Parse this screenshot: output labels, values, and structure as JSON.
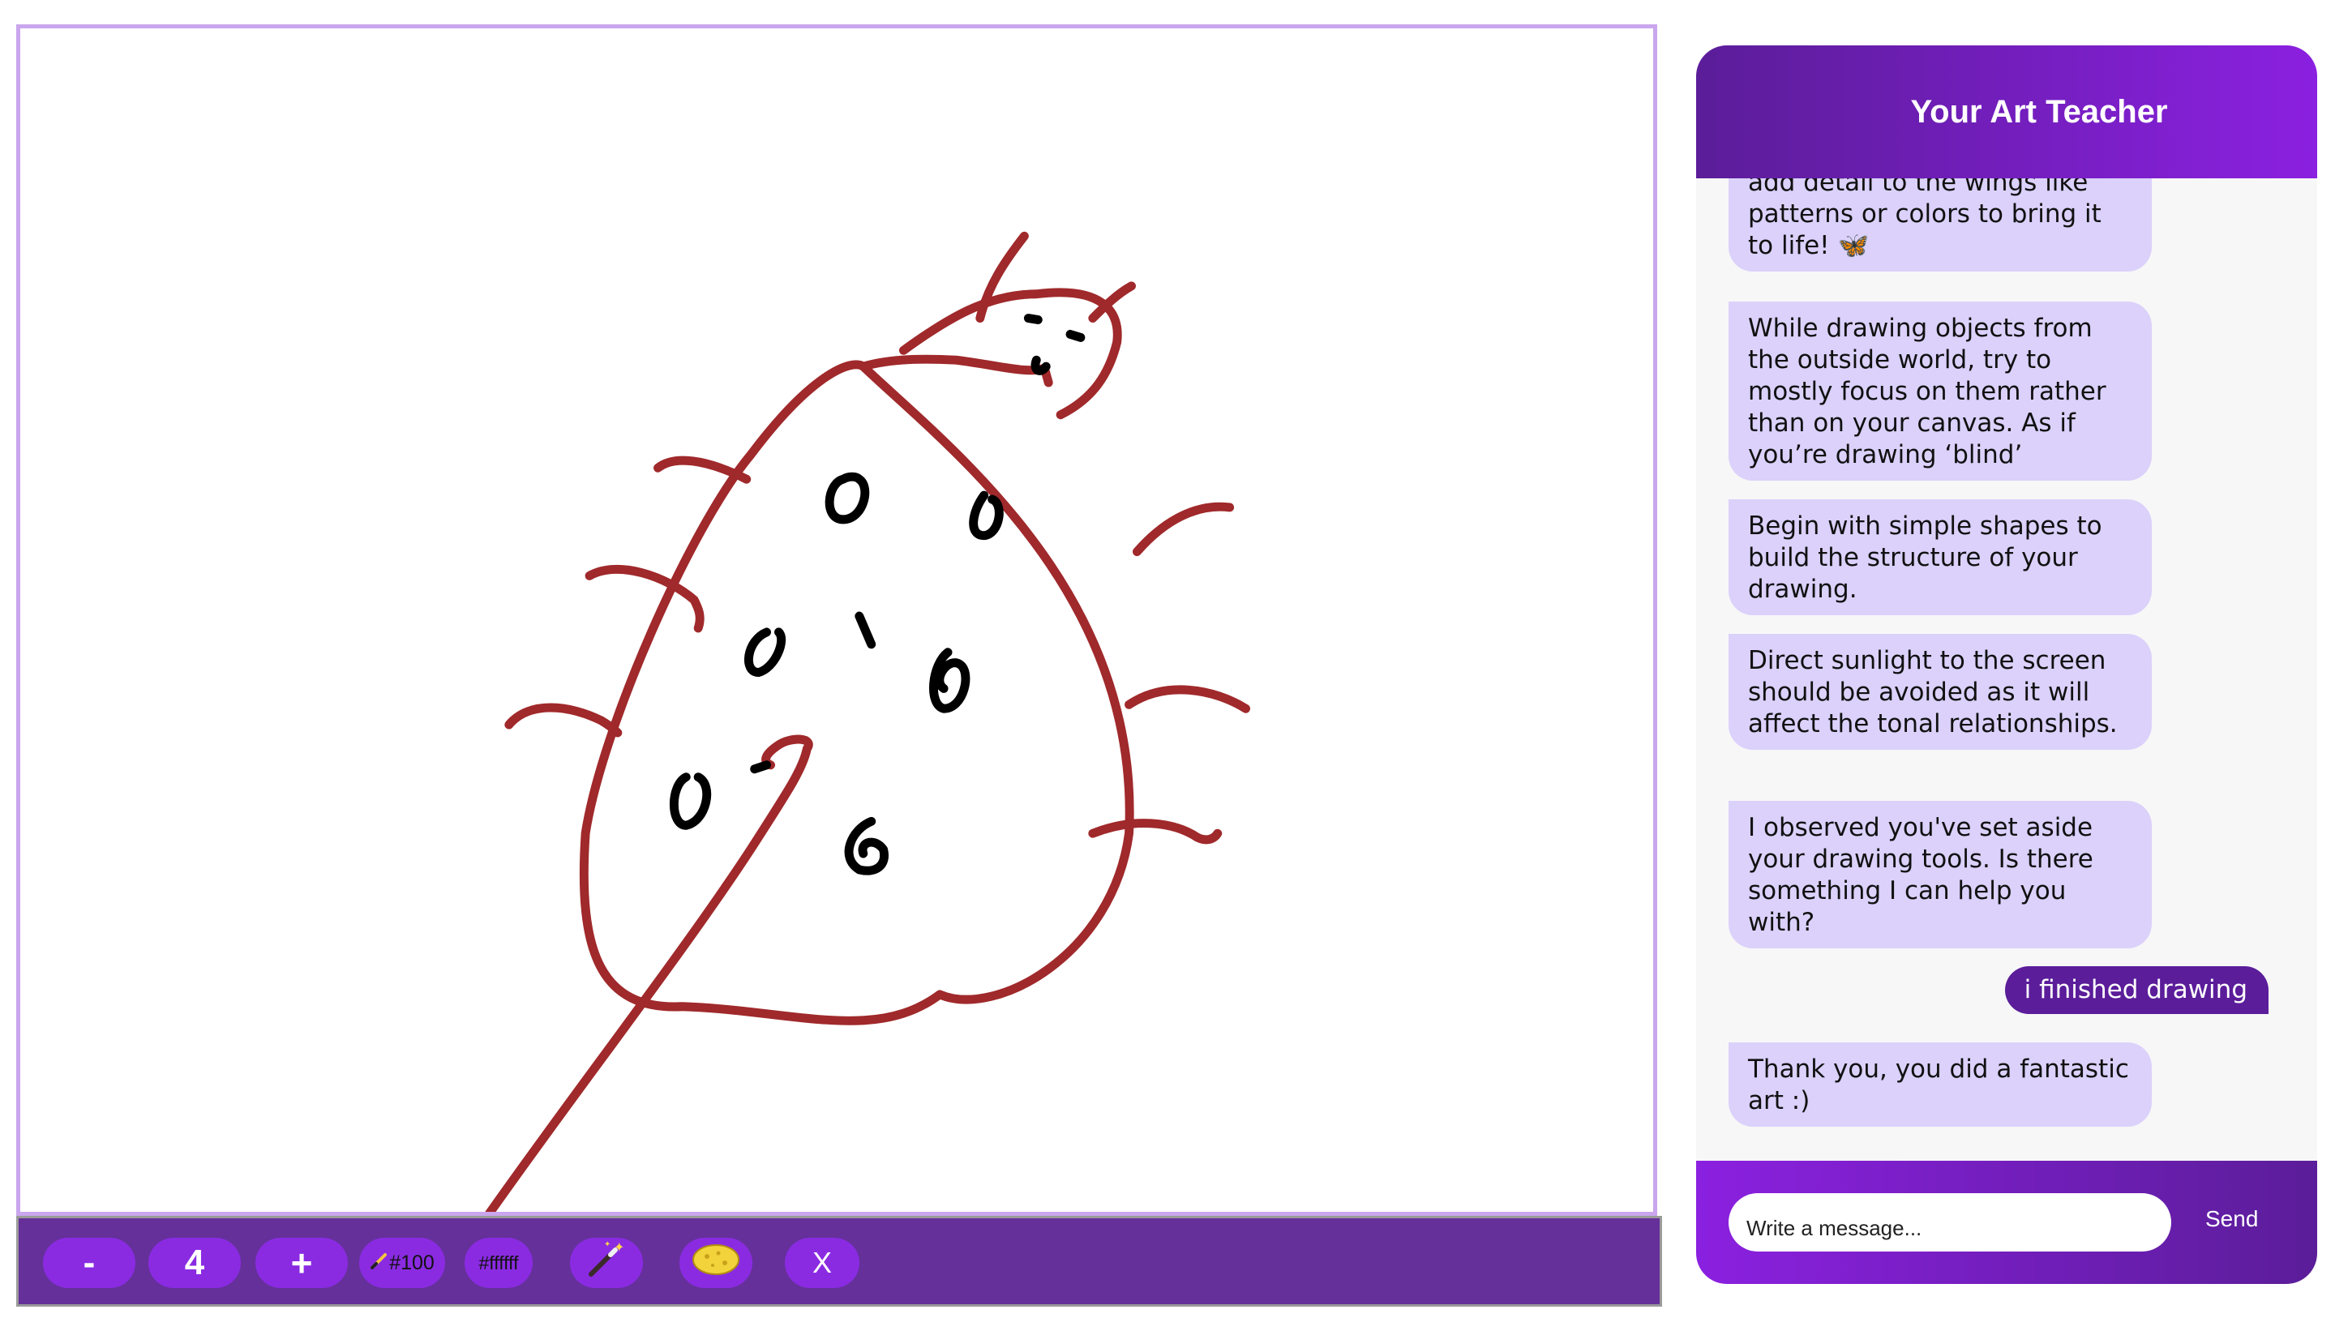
{
  "canvas": {
    "stroke_color": "#a0292b",
    "ink_color": "#000000"
  },
  "toolbar": {
    "decrease_label": "-",
    "brush_size": "4",
    "increase_label": "+",
    "brush_color_label": "#100",
    "background_color_label": "#ffffff",
    "magic_icon": "magic-wand-icon",
    "sponge_icon": "sponge-icon",
    "clear_label": "X"
  },
  "chat": {
    "title": "Your Art Teacher",
    "messages": [
      {
        "sender": "teacher",
        "text": "add detail to the wings like patterns or colors to bring it to life! 🦋"
      },
      {
        "sender": "teacher",
        "text": "While drawing objects from the outside world, try to mostly focus on them rather than on your canvas. As if you’re drawing ‘blind’"
      },
      {
        "sender": "teacher",
        "text": "Begin with simple shapes to build the structure of your drawing."
      },
      {
        "sender": "teacher",
        "text": "Direct sunlight to the screen should be avoided as it will affect the tonal relationships."
      },
      {
        "sender": "teacher",
        "text": "I observed you've set aside your drawing tools. Is there something I can help you with?"
      },
      {
        "sender": "user",
        "text": "i finished drawing"
      },
      {
        "sender": "teacher",
        "text": "Thank you, you did a fantastic art :)"
      }
    ],
    "input_placeholder": "Write a message...",
    "send_label": "Send"
  },
  "colors": {
    "accent": "#8a2be2",
    "header_dark": "#5b1d99",
    "toolbar": "#65309a",
    "teacher_bubble": "#dbd1fb",
    "user_bubble": "#5b1d9a",
    "canvas_border": "#c9a6ee"
  }
}
